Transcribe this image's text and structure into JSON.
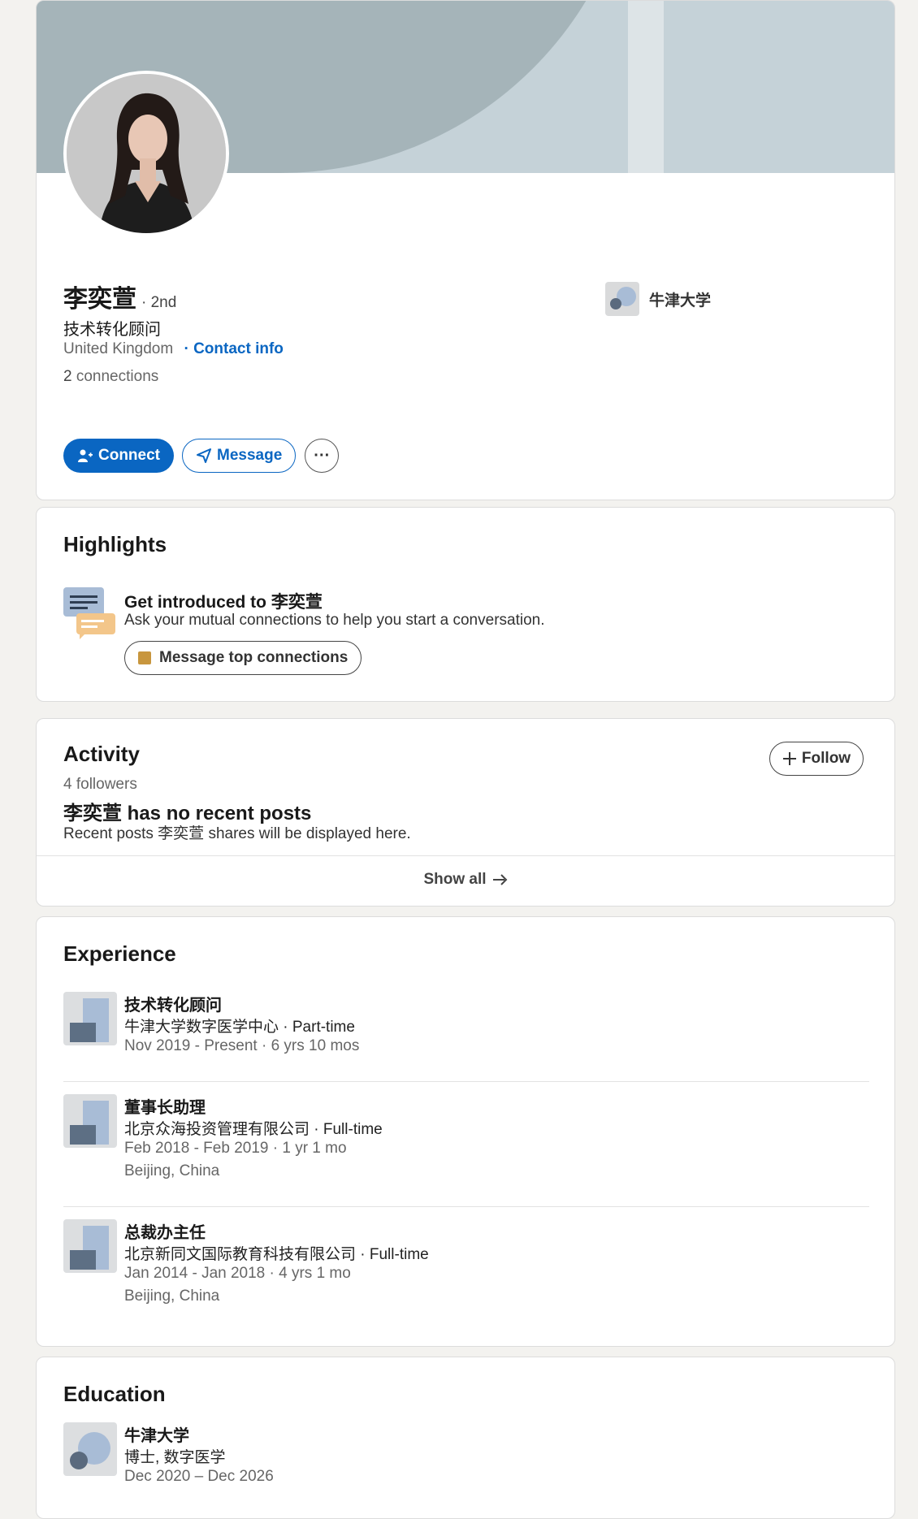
{
  "profile": {
    "name": "李奕萱",
    "degree": "· 2nd",
    "headline": "技术转化顾问",
    "location": "United Kingdom",
    "contact_info": "· Contact info",
    "connections_count": "2",
    "connections_label": "connections",
    "school": "牛津大学",
    "connect_label": "Connect",
    "message_label": "Message",
    "more_label": "···"
  },
  "highlights": {
    "title": "Highlights",
    "intro_title": "Get introduced to 李奕萱",
    "intro_sub": "Ask your mutual connections to help you start a conversation.",
    "button_label": "Message top connections"
  },
  "activity": {
    "title": "Activity",
    "followers": "4 followers",
    "follow_label": "Follow",
    "no_posts": "李奕萱 has no recent posts",
    "no_posts_sub": "Recent posts 李奕萱 shares will be displayed here.",
    "show_all": "Show all"
  },
  "experience": {
    "title": "Experience",
    "items": [
      {
        "title": "技术转化顾问",
        "company": "牛津大学数字医学中心 · Part-time",
        "dates": "Nov 2019 - Present · 6 yrs 10 mos",
        "location": ""
      },
      {
        "title": "董事长助理",
        "company": "北京众海投资管理有限公司 · Full-time",
        "dates": "Feb 2018 - Feb 2019 · 1 yr 1 mo",
        "location": "Beijing, China"
      },
      {
        "title": "总裁办主任",
        "company": "北京新同文国际教育科技有限公司 · Full-time",
        "dates": "Jan 2014 - Jan 2018 · 4 yrs 1 mo",
        "location": "Beijing, China"
      }
    ]
  },
  "education": {
    "title": "Education",
    "school": "牛津大学",
    "degree": "博士, 数字医学",
    "dates": "Dec 2020 – Dec 2026"
  },
  "colors": {
    "brand_blue": "#0a66c2",
    "banner": "#c5d2d8",
    "banner_arc": "#a5b4b9",
    "page_bg": "#f3f2ef"
  }
}
